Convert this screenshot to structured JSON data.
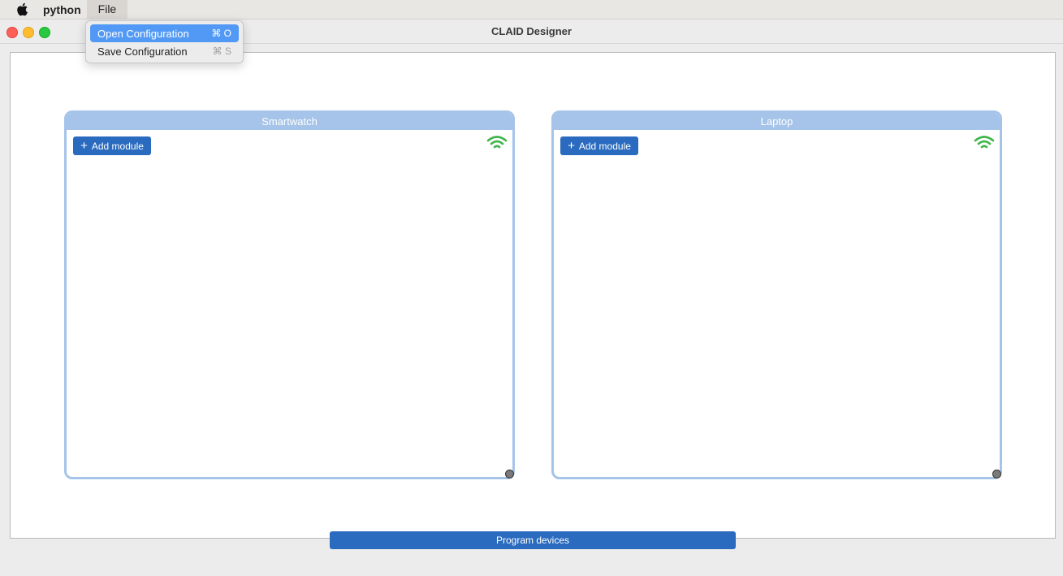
{
  "menubar": {
    "app_name": "python",
    "menus": [
      "File"
    ]
  },
  "window": {
    "title": "CLAID Designer"
  },
  "file_menu": {
    "items": [
      {
        "label": "Open Configuration",
        "shortcut": "⌘ O",
        "highlighted": true
      },
      {
        "label": "Save Configuration",
        "shortcut": "⌘ S",
        "highlighted": false
      }
    ]
  },
  "devices": [
    {
      "name": "Smartwatch",
      "add_label": "Add module",
      "status_icon": "wifi-icon"
    },
    {
      "name": "Laptop",
      "add_label": "Add module",
      "status_icon": "wifi-icon"
    }
  ],
  "footer": {
    "program_label": "Program devices"
  },
  "colors": {
    "accent": "#2a6bbf",
    "device_header": "#a6c4e9",
    "wifi": "#3fb54a",
    "menu_highlight": "#5299f5"
  }
}
